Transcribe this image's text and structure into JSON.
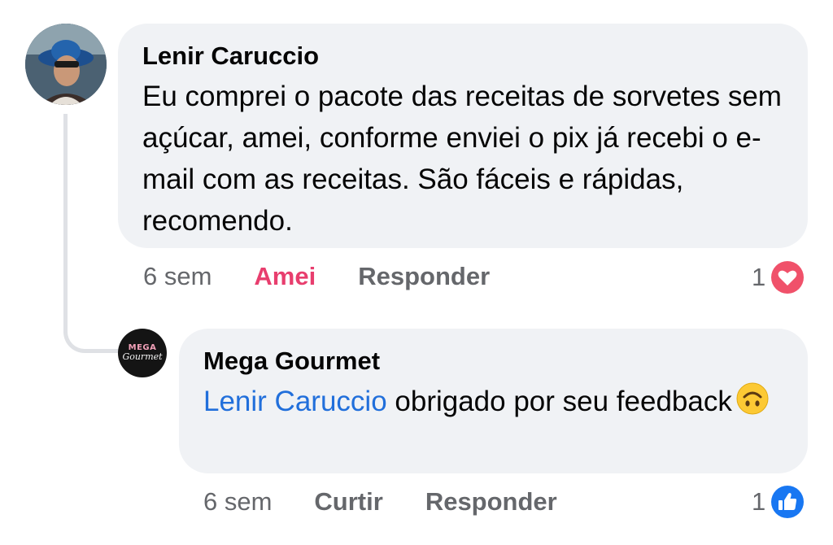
{
  "comments": [
    {
      "author": "Lenir Caruccio",
      "text": "Eu comprei o pacote das receitas de sorvetes sem açúcar, amei, conforme enviei o pix já recebi o e-mail com as receitas. São fáceis e rápidas, recomendo.",
      "time": "6 sem",
      "reaction_label": "Amei",
      "reply_label": "Responder",
      "reaction_count": "1",
      "reaction_icon": "love-icon",
      "reaction_color": "#e83e6e"
    }
  ],
  "reply": {
    "author": "Mega Gourmet",
    "mention": "Lenir Caruccio",
    "text": "obrigado por seu feedback",
    "emoji": "upside-down-face-emoji",
    "time": "6 sem",
    "reaction_label": "Curtir",
    "reply_label": "Responder",
    "reaction_count": "1",
    "reaction_icon": "like-icon",
    "logo_top": "MEGA",
    "logo_bottom": "Gourmet"
  },
  "colors": {
    "bubble": "#f0f2f5",
    "mention": "#216fdb",
    "meta": "#65676b",
    "like": "#1877f2"
  }
}
